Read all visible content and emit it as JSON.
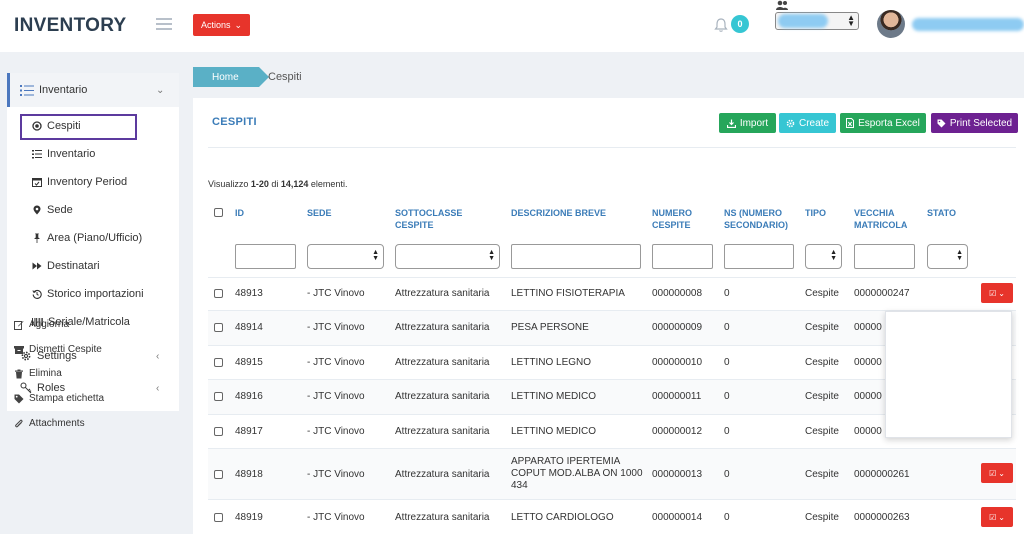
{
  "app": {
    "title": "INVENTORY"
  },
  "topbar": {
    "actions_label": "Actions",
    "notifications_count": "0"
  },
  "sidebar": {
    "items": [
      {
        "label": "Inventario"
      },
      {
        "label": "Cespiti"
      },
      {
        "label": "Inventario"
      },
      {
        "label": "Inventory Period"
      },
      {
        "label": "Sede"
      },
      {
        "label": "Area (Piano/Ufficio)"
      },
      {
        "label": "Destinatari"
      },
      {
        "label": "Storico importazioni"
      },
      {
        "label": "Seriale/Matricola"
      },
      {
        "label": "Settings"
      },
      {
        "label": "Roles"
      }
    ]
  },
  "breadcrumb": {
    "home": "Home",
    "current": "Cespiti"
  },
  "page": {
    "title": "CESPITI",
    "buttons": {
      "import": "Import",
      "create": "Create",
      "export": "Esporta Excel",
      "print": "Print Selected"
    },
    "showing": {
      "prefix": "Visualizzo ",
      "range": "1-20",
      "middle": " di ",
      "total": "14,124",
      "suffix": " elementi."
    },
    "colors": {
      "accent": "#3b7cb8",
      "danger": "#e7342b",
      "teal": "#36c6d3",
      "green": "#26a65b",
      "purple": "#6d2191"
    }
  },
  "table": {
    "headers": {
      "id": "ID",
      "sede": "SEDE",
      "sottoclasse": [
        "SOTTOCLASSE",
        "CESPITE"
      ],
      "descrizione": "DESCRIZIONE BREVE",
      "numero": [
        "NUMERO",
        "CESPITE"
      ],
      "ns": [
        "NS (NUMERO",
        "SECONDARIO)"
      ],
      "tipo": "TIPO",
      "vecchia": [
        "VECCHIA",
        "MATRICOLA"
      ],
      "stato": "STATO"
    },
    "rows": [
      {
        "id": "48913",
        "sede": "- JTC Vinovo",
        "sottoclasse": "Attrezzatura sanitaria",
        "descrizione": [
          "LETTINO FISIOTERAPIA"
        ],
        "numero": "000000008",
        "ns": "0",
        "tipo": "Cespite",
        "vecchia": "0000000247"
      },
      {
        "id": "48914",
        "sede": "- JTC Vinovo",
        "sottoclasse": "Attrezzatura sanitaria",
        "descrizione": [
          "PESA PERSONE"
        ],
        "numero": "000000009",
        "ns": "0",
        "tipo": "Cespite",
        "vecchia": "00000"
      },
      {
        "id": "48915",
        "sede": "- JTC Vinovo",
        "sottoclasse": "Attrezzatura sanitaria",
        "descrizione": [
          "LETTINO LEGNO"
        ],
        "numero": "000000010",
        "ns": "0",
        "tipo": "Cespite",
        "vecchia": "00000"
      },
      {
        "id": "48916",
        "sede": "- JTC Vinovo",
        "sottoclasse": "Attrezzatura sanitaria",
        "descrizione": [
          "LETTINO MEDICO"
        ],
        "numero": "000000011",
        "ns": "0",
        "tipo": "Cespite",
        "vecchia": "00000"
      },
      {
        "id": "48917",
        "sede": "- JTC Vinovo",
        "sottoclasse": "Attrezzatura sanitaria",
        "descrizione": [
          "LETTINO MEDICO"
        ],
        "numero": "000000012",
        "ns": "0",
        "tipo": "Cespite",
        "vecchia": "00000"
      },
      {
        "id": "48918",
        "sede": "- JTC Vinovo",
        "sottoclasse": "Attrezzatura sanitaria",
        "descrizione": [
          "APPARATO IPERTEMIA",
          "COPUT MOD.ALBA ON 1000",
          "434"
        ],
        "numero": "000000013",
        "ns": "0",
        "tipo": "Cespite",
        "vecchia": "0000000261"
      },
      {
        "id": "48919",
        "sede": "- JTC Vinovo",
        "sottoclasse": "Attrezzatura sanitaria",
        "descrizione": [
          "LETTO CARDIOLOGO"
        ],
        "numero": "000000014",
        "ns": "0",
        "tipo": "Cespite",
        "vecchia": "0000000263"
      }
    ]
  },
  "row_menu": {
    "items": [
      {
        "label": "Aggiorna",
        "icon": "edit-icon"
      },
      {
        "label": "Dismetti Cespite",
        "icon": "archive-icon"
      },
      {
        "label": "Elimina",
        "icon": "trash-icon"
      },
      {
        "label": "Stampa etichetta",
        "icon": "tag-icon"
      },
      {
        "label": "Attachments",
        "icon": "paperclip-icon"
      }
    ]
  }
}
